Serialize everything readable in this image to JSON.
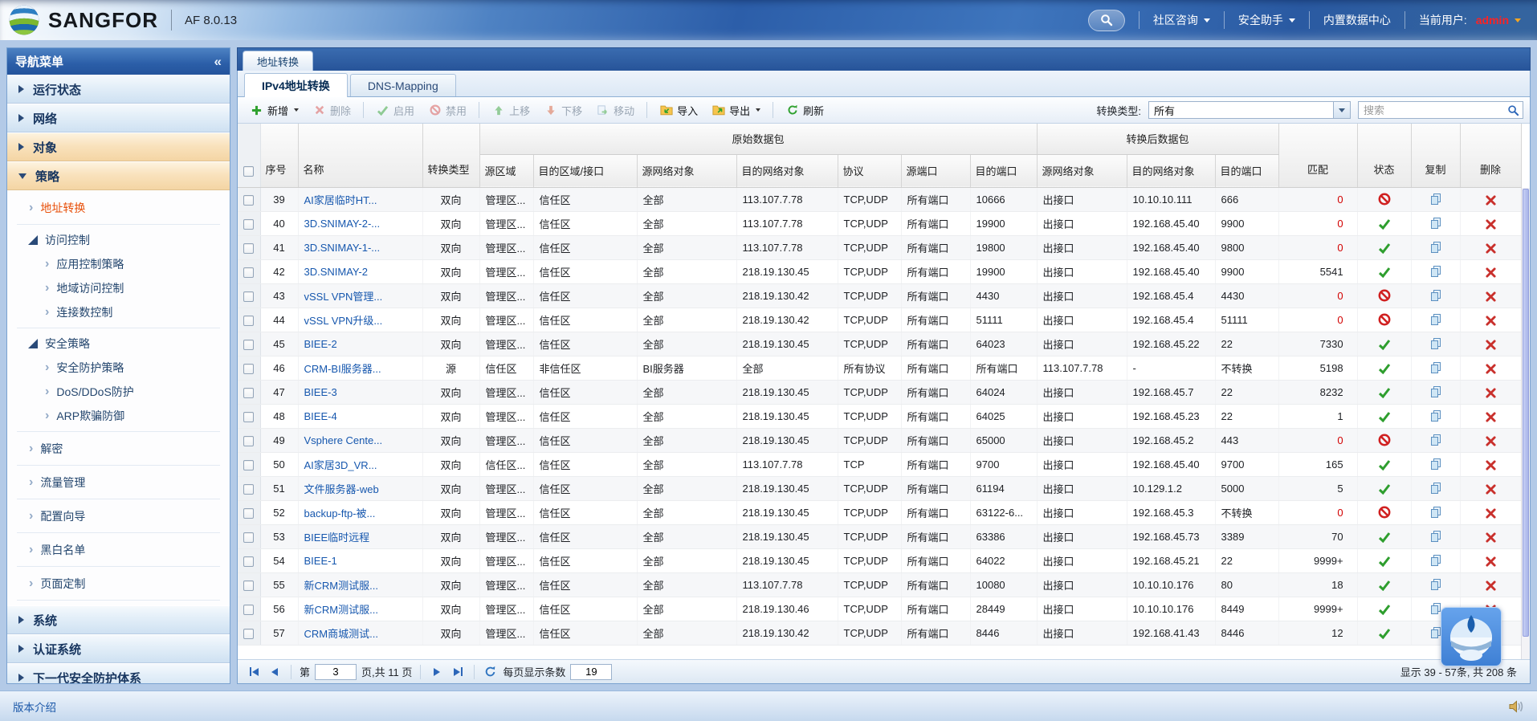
{
  "colors": {
    "accent_blue": "#2b62ab",
    "link_blue": "#1657ae",
    "selected_nav_orange": "#e8500a",
    "status_enabled_green": "#2e9e2e",
    "status_disabled_red": "#d02020",
    "match_zero_red": "#d20000",
    "admin_red": "#ff2222"
  },
  "topbar": {
    "brand": "SANGFOR",
    "version": "AF 8.0.13",
    "menu": [
      {
        "key": "community-consult",
        "label": "社区咨询"
      },
      {
        "key": "security-assistant",
        "label": "安全助手"
      },
      {
        "key": "builtin-data-center",
        "label": "内置数据中心"
      }
    ],
    "current_user_label": "当前用户:",
    "current_user": "admin"
  },
  "sidebar": {
    "title": "导航菜单",
    "collapse_icon": "«",
    "groups": [
      {
        "key": "running-status",
        "label": "运行状态",
        "tone": "blue",
        "state": "collapsed"
      },
      {
        "key": "network",
        "label": "网络",
        "tone": "blue",
        "state": "collapsed"
      },
      {
        "key": "objects",
        "label": "对象",
        "tone": "tan",
        "state": "collapsed"
      },
      {
        "key": "policy",
        "label": "策略",
        "tone": "tan",
        "state": "expanded"
      }
    ],
    "policy_tree": [
      {
        "type": "leaf",
        "key": "nat",
        "label": "地址转换",
        "selected": true
      },
      {
        "type": "branch",
        "key": "access-control",
        "label": "访问控制",
        "children": [
          {
            "key": "app-control-policy",
            "label": "应用控制策略"
          },
          {
            "key": "geo-access-control",
            "label": "地域访问控制"
          },
          {
            "key": "connection-limit",
            "label": "连接数控制"
          }
        ]
      },
      {
        "type": "branch",
        "key": "security-policy",
        "label": "安全策略",
        "children": [
          {
            "key": "security-protection-policy",
            "label": "安全防护策略"
          },
          {
            "key": "dos-ddos-protection",
            "label": "DoS/DDoS防护"
          },
          {
            "key": "arp-spoofing-defense",
            "label": "ARP欺骗防御"
          }
        ]
      },
      {
        "type": "leaf",
        "key": "decryption",
        "label": "解密"
      },
      {
        "type": "leaf",
        "key": "traffic-management",
        "label": "流量管理"
      },
      {
        "type": "leaf",
        "key": "config-wizard",
        "label": "配置向导"
      },
      {
        "type": "leaf",
        "key": "blacklist-whitelist",
        "label": "黑白名单"
      },
      {
        "type": "leaf",
        "key": "page-customization",
        "label": "页面定制"
      }
    ],
    "bottom_groups": [
      {
        "key": "system",
        "label": "系统"
      },
      {
        "key": "auth-system",
        "label": "认证系统"
      },
      {
        "key": "ngaf-framework",
        "label": "下一代安全防护体系"
      }
    ]
  },
  "main": {
    "window_tab": "地址转换",
    "tabs": [
      {
        "key": "ipv4-nat",
        "label": "IPv4地址转换",
        "active": true
      },
      {
        "key": "dns-mapping",
        "label": "DNS-Mapping",
        "active": false
      }
    ],
    "toolbar": {
      "buttons": [
        {
          "key": "add",
          "label": "新增",
          "icon": "plus",
          "enabled": true,
          "caret": true
        },
        {
          "key": "delete",
          "label": "删除",
          "icon": "cross",
          "enabled": false,
          "sep_after": true
        },
        {
          "key": "enable",
          "label": "启用",
          "icon": "check",
          "enabled": false
        },
        {
          "key": "disable",
          "label": "禁用",
          "icon": "prohibit",
          "enabled": false,
          "sep_after": true
        },
        {
          "key": "move-up",
          "label": "上移",
          "icon": "arrow-up",
          "enabled": false
        },
        {
          "key": "move-down",
          "label": "下移",
          "icon": "arrow-down",
          "enabled": false
        },
        {
          "key": "move",
          "label": "移动",
          "icon": "move",
          "enabled": false,
          "sep_after": true
        },
        {
          "key": "import",
          "label": "导入",
          "icon": "import",
          "enabled": true
        },
        {
          "key": "export",
          "label": "导出",
          "icon": "export",
          "enabled": true,
          "caret": true,
          "sep_after": true
        },
        {
          "key": "refresh",
          "label": "刷新",
          "icon": "refresh",
          "enabled": true
        }
      ],
      "filter_label": "转换类型:",
      "filter_value": "所有",
      "search_placeholder": "搜索"
    },
    "table": {
      "group_original": "原始数据包",
      "group_translated": "转换后数据包",
      "columns": [
        "序号",
        "名称",
        "转换类型",
        "源区域",
        "目的区域/接口",
        "源网络对象",
        "目的网络对象",
        "协议",
        "源端口",
        "目的端口",
        "源网络对象",
        "目的网络对象",
        "目的端口",
        "匹配",
        "状态",
        "复制",
        "删除"
      ],
      "rows": [
        {
          "seq": "39",
          "name": "AI家居临时HT...",
          "type": "双向",
          "src_zone": "管理区...",
          "dst_zone": "信任区",
          "src_obj": "全部",
          "dst_obj": "113.107.7.78",
          "proto": "TCP,UDP",
          "src_port": "所有端口",
          "dst_port": "10666",
          "t_src_obj": "出接口",
          "t_dst_obj": "10.10.10.111",
          "t_dst_port": "666",
          "match": "0",
          "status": "disabled"
        },
        {
          "seq": "40",
          "name": "3D.SNIMAY-2-...",
          "type": "双向",
          "src_zone": "管理区...",
          "dst_zone": "信任区",
          "src_obj": "全部",
          "dst_obj": "113.107.7.78",
          "proto": "TCP,UDP",
          "src_port": "所有端口",
          "dst_port": "19900",
          "t_src_obj": "出接口",
          "t_dst_obj": "192.168.45.40",
          "t_dst_port": "9900",
          "match": "0",
          "status": "enabled"
        },
        {
          "seq": "41",
          "name": "3D.SNIMAY-1-...",
          "type": "双向",
          "src_zone": "管理区...",
          "dst_zone": "信任区",
          "src_obj": "全部",
          "dst_obj": "113.107.7.78",
          "proto": "TCP,UDP",
          "src_port": "所有端口",
          "dst_port": "19800",
          "t_src_obj": "出接口",
          "t_dst_obj": "192.168.45.40",
          "t_dst_port": "9800",
          "match": "0",
          "status": "enabled"
        },
        {
          "seq": "42",
          "name": "3D.SNIMAY-2",
          "type": "双向",
          "src_zone": "管理区...",
          "dst_zone": "信任区",
          "src_obj": "全部",
          "dst_obj": "218.19.130.45",
          "proto": "TCP,UDP",
          "src_port": "所有端口",
          "dst_port": "19900",
          "t_src_obj": "出接口",
          "t_dst_obj": "192.168.45.40",
          "t_dst_port": "9900",
          "match": "5541",
          "status": "enabled"
        },
        {
          "seq": "43",
          "name": "vSSL VPN管理...",
          "type": "双向",
          "src_zone": "管理区...",
          "dst_zone": "信任区",
          "src_obj": "全部",
          "dst_obj": "218.19.130.42",
          "proto": "TCP,UDP",
          "src_port": "所有端口",
          "dst_port": "4430",
          "t_src_obj": "出接口",
          "t_dst_obj": "192.168.45.4",
          "t_dst_port": "4430",
          "match": "0",
          "status": "disabled"
        },
        {
          "seq": "44",
          "name": "vSSL VPN升级...",
          "type": "双向",
          "src_zone": "管理区...",
          "dst_zone": "信任区",
          "src_obj": "全部",
          "dst_obj": "218.19.130.42",
          "proto": "TCP,UDP",
          "src_port": "所有端口",
          "dst_port": "51111",
          "t_src_obj": "出接口",
          "t_dst_obj": "192.168.45.4",
          "t_dst_port": "51111",
          "match": "0",
          "status": "disabled"
        },
        {
          "seq": "45",
          "name": "BIEE-2",
          "type": "双向",
          "src_zone": "管理区...",
          "dst_zone": "信任区",
          "src_obj": "全部",
          "dst_obj": "218.19.130.45",
          "proto": "TCP,UDP",
          "src_port": "所有端口",
          "dst_port": "64023",
          "t_src_obj": "出接口",
          "t_dst_obj": "192.168.45.22",
          "t_dst_port": "22",
          "match": "7330",
          "status": "enabled"
        },
        {
          "seq": "46",
          "name": "CRM-BI服务器...",
          "type": "源",
          "src_zone": "信任区",
          "dst_zone": "非信任区",
          "src_obj": "BI服务器",
          "dst_obj": "全部",
          "proto": "所有协议",
          "src_port": "所有端口",
          "dst_port": "所有端口",
          "t_src_obj": "113.107.7.78",
          "t_dst_obj": "-",
          "t_dst_port": "不转换",
          "match": "5198",
          "status": "enabled"
        },
        {
          "seq": "47",
          "name": "BIEE-3",
          "type": "双向",
          "src_zone": "管理区...",
          "dst_zone": "信任区",
          "src_obj": "全部",
          "dst_obj": "218.19.130.45",
          "proto": "TCP,UDP",
          "src_port": "所有端口",
          "dst_port": "64024",
          "t_src_obj": "出接口",
          "t_dst_obj": "192.168.45.7",
          "t_dst_port": "22",
          "match": "8232",
          "status": "enabled"
        },
        {
          "seq": "48",
          "name": "BIEE-4",
          "type": "双向",
          "src_zone": "管理区...",
          "dst_zone": "信任区",
          "src_obj": "全部",
          "dst_obj": "218.19.130.45",
          "proto": "TCP,UDP",
          "src_port": "所有端口",
          "dst_port": "64025",
          "t_src_obj": "出接口",
          "t_dst_obj": "192.168.45.23",
          "t_dst_port": "22",
          "match": "1",
          "status": "enabled"
        },
        {
          "seq": "49",
          "name": "Vsphere Cente...",
          "type": "双向",
          "src_zone": "管理区...",
          "dst_zone": "信任区",
          "src_obj": "全部",
          "dst_obj": "218.19.130.45",
          "proto": "TCP,UDP",
          "src_port": "所有端口",
          "dst_port": "65000",
          "t_src_obj": "出接口",
          "t_dst_obj": "192.168.45.2",
          "t_dst_port": "443",
          "match": "0",
          "status": "disabled"
        },
        {
          "seq": "50",
          "name": "AI家居3D_VR...",
          "type": "双向",
          "src_zone": "信任区...",
          "dst_zone": "信任区",
          "src_obj": "全部",
          "dst_obj": "113.107.7.78",
          "proto": "TCP",
          "src_port": "所有端口",
          "dst_port": "9700",
          "t_src_obj": "出接口",
          "t_dst_obj": "192.168.45.40",
          "t_dst_port": "9700",
          "match": "165",
          "status": "enabled"
        },
        {
          "seq": "51",
          "name": "文件服务器-web",
          "type": "双向",
          "src_zone": "管理区...",
          "dst_zone": "信任区",
          "src_obj": "全部",
          "dst_obj": "218.19.130.45",
          "proto": "TCP,UDP",
          "src_port": "所有端口",
          "dst_port": "61194",
          "t_src_obj": "出接口",
          "t_dst_obj": "10.129.1.2",
          "t_dst_port": "5000",
          "match": "5",
          "status": "enabled"
        },
        {
          "seq": "52",
          "name": "backup-ftp-被...",
          "type": "双向",
          "src_zone": "管理区...",
          "dst_zone": "信任区",
          "src_obj": "全部",
          "dst_obj": "218.19.130.45",
          "proto": "TCP,UDP",
          "src_port": "所有端口",
          "dst_port": "63122-6...",
          "t_src_obj": "出接口",
          "t_dst_obj": "192.168.45.3",
          "t_dst_port": "不转换",
          "match": "0",
          "status": "disabled"
        },
        {
          "seq": "53",
          "name": "BIEE临时远程",
          "type": "双向",
          "src_zone": "管理区...",
          "dst_zone": "信任区",
          "src_obj": "全部",
          "dst_obj": "218.19.130.45",
          "proto": "TCP,UDP",
          "src_port": "所有端口",
          "dst_port": "63386",
          "t_src_obj": "出接口",
          "t_dst_obj": "192.168.45.73",
          "t_dst_port": "3389",
          "match": "70",
          "status": "enabled"
        },
        {
          "seq": "54",
          "name": "BIEE-1",
          "type": "双向",
          "src_zone": "管理区...",
          "dst_zone": "信任区",
          "src_obj": "全部",
          "dst_obj": "218.19.130.45",
          "proto": "TCP,UDP",
          "src_port": "所有端口",
          "dst_port": "64022",
          "t_src_obj": "出接口",
          "t_dst_obj": "192.168.45.21",
          "t_dst_port": "22",
          "match": "9999+",
          "status": "enabled"
        },
        {
          "seq": "55",
          "name": "新CRM测试服...",
          "type": "双向",
          "src_zone": "管理区...",
          "dst_zone": "信任区",
          "src_obj": "全部",
          "dst_obj": "113.107.7.78",
          "proto": "TCP,UDP",
          "src_port": "所有端口",
          "dst_port": "10080",
          "t_src_obj": "出接口",
          "t_dst_obj": "10.10.10.176",
          "t_dst_port": "80",
          "match": "18",
          "status": "enabled"
        },
        {
          "seq": "56",
          "name": "新CRM测试服...",
          "type": "双向",
          "src_zone": "管理区...",
          "dst_zone": "信任区",
          "src_obj": "全部",
          "dst_obj": "218.19.130.46",
          "proto": "TCP,UDP",
          "src_port": "所有端口",
          "dst_port": "28449",
          "t_src_obj": "出接口",
          "t_dst_obj": "10.10.10.176",
          "t_dst_port": "8449",
          "match": "9999+",
          "status": "enabled"
        },
        {
          "seq": "57",
          "name": "CRM商城测试...",
          "type": "双向",
          "src_zone": "管理区...",
          "dst_zone": "信任区",
          "src_obj": "全部",
          "dst_obj": "218.19.130.42",
          "proto": "TCP,UDP",
          "src_port": "所有端口",
          "dst_port": "8446",
          "t_src_obj": "出接口",
          "t_dst_obj": "192.168.41.43",
          "t_dst_port": "8446",
          "match": "12",
          "status": "enabled"
        }
      ]
    },
    "pager": {
      "page_prefix": "第",
      "page_value": "3",
      "page_suffix": "页,共 11 页",
      "per_page_label": "每页显示条数",
      "per_page_value": "19",
      "summary": "显示 39 - 57条, 共 208 条"
    }
  },
  "statusbar": {
    "version_link": "版本介绍"
  }
}
